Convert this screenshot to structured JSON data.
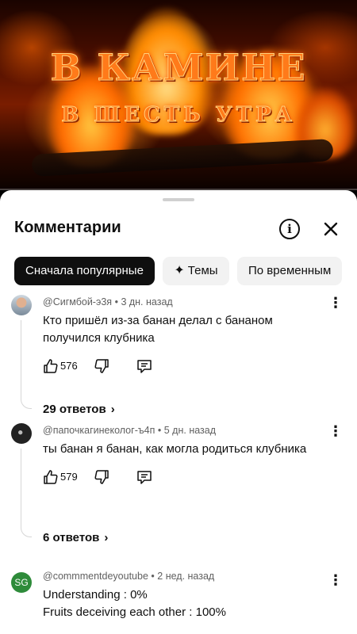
{
  "video": {
    "title_line1": "В КАМИНЕ",
    "title_line2": "В ШЕСТЬ УТРА"
  },
  "sheet": {
    "title": "Комментарии",
    "info_icon": "info-icon",
    "close_icon": "close-icon"
  },
  "filters": [
    {
      "label": "Сначала популярные",
      "active": true
    },
    {
      "label": "Темы",
      "icon": "sparkle-icon",
      "active": false
    },
    {
      "label": "По временным",
      "active": false
    }
  ],
  "comments": [
    {
      "author": "@Сигмбой-э3я",
      "time": "3 дн. назад",
      "text_lines": [
        "Кто пришёл из-за банан делал с бананом",
        "получился клубника"
      ],
      "likes": "576",
      "replies": "29 ответов"
    },
    {
      "author": "@папочкагинеколог-ъ4п",
      "time": "5 дн. назад",
      "text_lines": [
        "ты банан я банан, как могла родиться клубника"
      ],
      "likes": "579",
      "replies": "6 ответов"
    },
    {
      "author": "@commmentdeyoutube",
      "time": "2 нед. назад",
      "avatar_text": "SG",
      "text_lines": [
        "Understanding : 0%",
        "Fruits deceiving each other : 100%"
      ]
    }
  ],
  "separator": "•",
  "colors": {
    "accent": "#0f0f0f",
    "secondary_text": "#606060",
    "chip_bg": "#f2f2f2",
    "avatar_sg": "#2e8b3a"
  }
}
